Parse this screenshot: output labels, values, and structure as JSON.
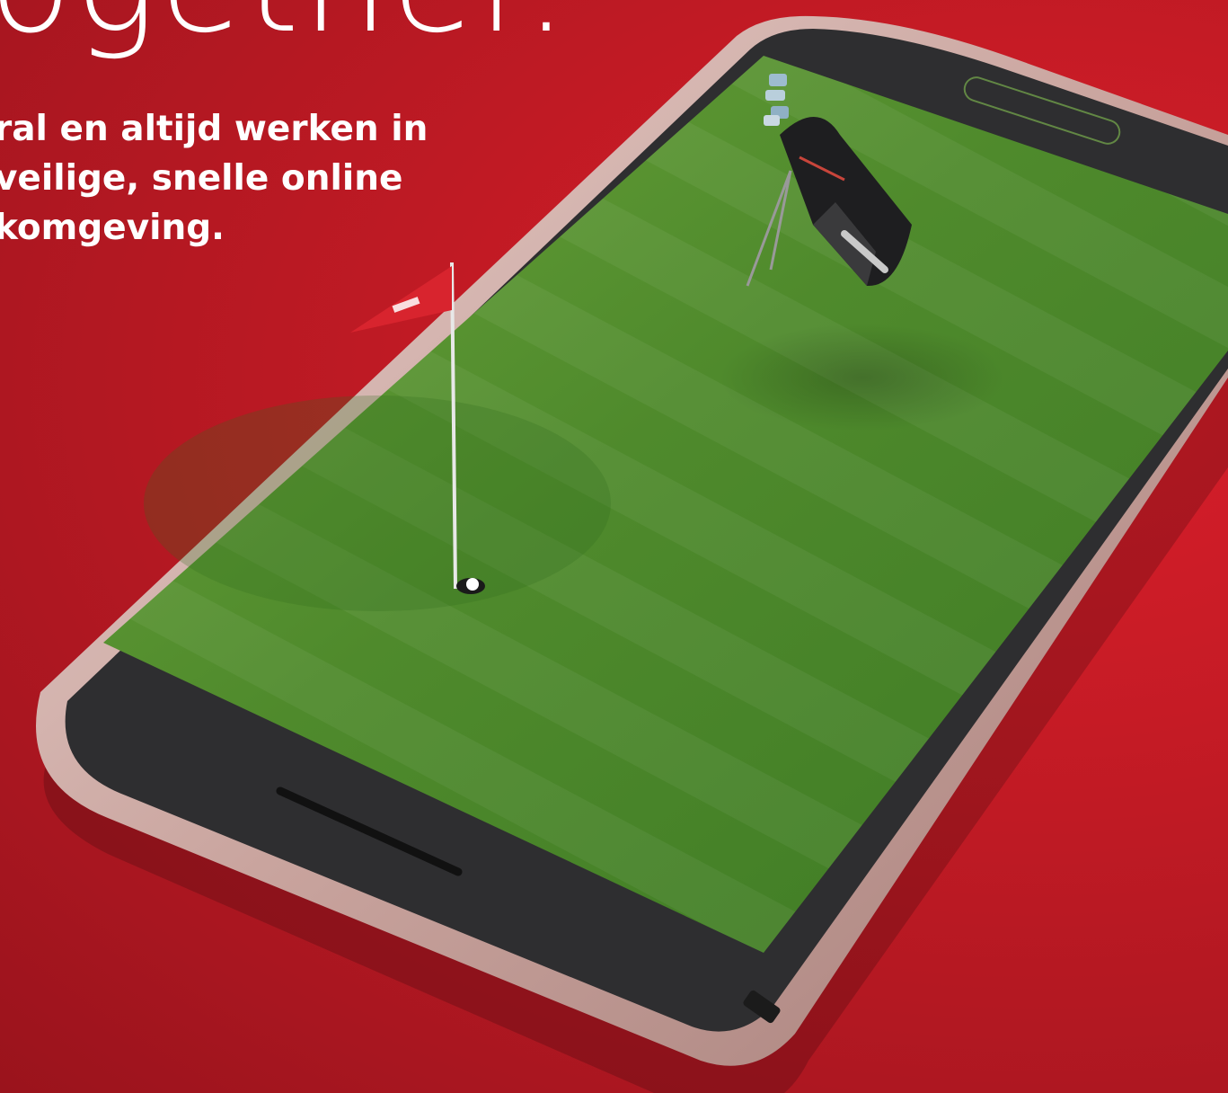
{
  "headline": "ogether.",
  "subcopy": {
    "lines": [
      "ral en altijd werken in",
      "veilige, snelle online",
      "komgeving."
    ]
  },
  "illustration": {
    "subject": "phone-with-golf-green-screen",
    "colors": {
      "background": "#c51b25",
      "phone_frame": "#c9a49e",
      "bezel": "#2e2e30",
      "grass": "#4f8a2c",
      "flag": "#d8242e"
    }
  }
}
